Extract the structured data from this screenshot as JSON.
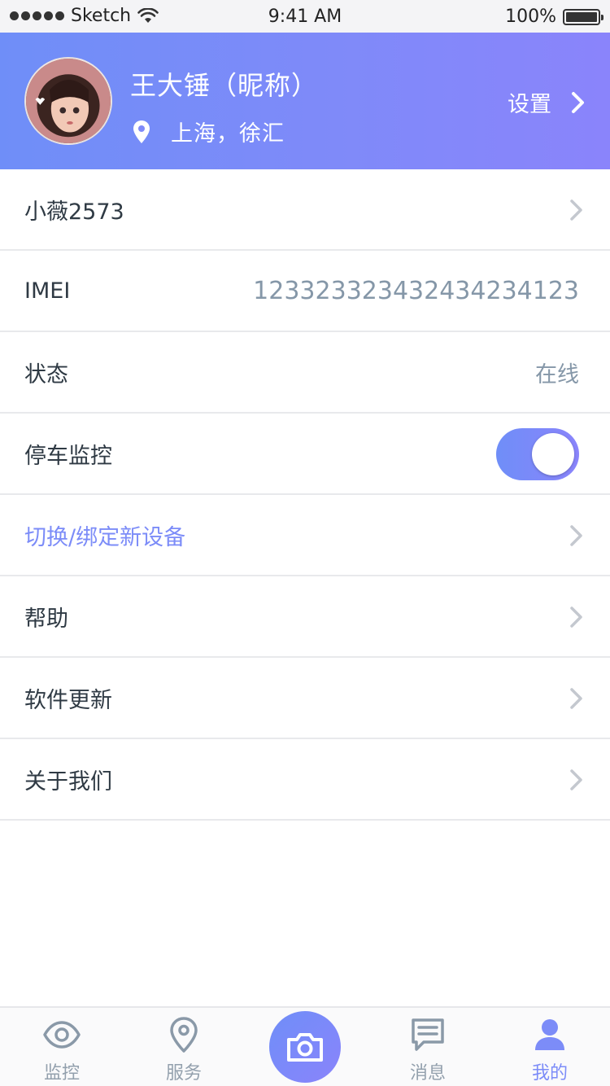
{
  "status_bar": {
    "carrier": "Sketch",
    "time": "9:41 AM",
    "battery": "100%"
  },
  "header": {
    "user_name": "王大锤（昵称）",
    "location": "上海，徐汇",
    "settings_label": "设置"
  },
  "list": {
    "device_name": "小薇2573",
    "imei_label": "IMEI",
    "imei_value": "12332332343243423412​3",
    "status_label": "状态",
    "status_value": "在线",
    "parking_monitor_label": "停车监控",
    "parking_monitor_on": true,
    "switch_device_label": "切换/绑定新设备",
    "help_label": "帮助",
    "software_update_label": "软件更新",
    "about_label": "关于我们"
  },
  "tabbar": {
    "monitor_label": "监控",
    "service_label": "服务",
    "messages_label": "消息",
    "mine_label": "我的",
    "active_tab": "我的"
  },
  "colors": {
    "accent": "#7c8cf8",
    "header_start": "#6f8ef8",
    "header_end": "#8a84fb",
    "muted_text": "#8597a8"
  },
  "icons": {
    "location": "location-pin-icon",
    "chevron": "chevron-right-icon",
    "monitor": "eye-icon",
    "service": "map-pin-icon",
    "camera": "camera-icon",
    "messages": "chat-bubble-icon",
    "mine": "person-icon"
  }
}
